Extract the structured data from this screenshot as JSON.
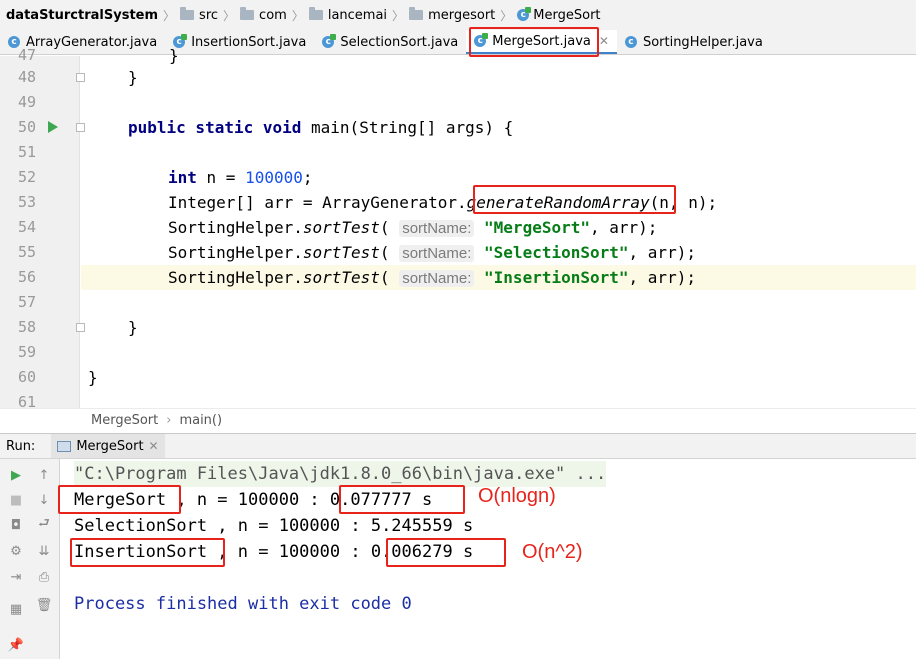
{
  "breadcrumb": {
    "items": [
      "dataSturctralSystem",
      "src",
      "com",
      "lancemai",
      "mergesort",
      "MergeSort"
    ]
  },
  "tabs": [
    {
      "label": "ArrayGenerator.java"
    },
    {
      "label": "InsertionSort.java"
    },
    {
      "label": "SelectionSort.java"
    },
    {
      "label": "MergeSort.java",
      "active": true
    },
    {
      "label": "SortingHelper.java"
    }
  ],
  "editor": {
    "current_line": "56",
    "lines": [
      {
        "num": "47",
        "code": "}"
      },
      {
        "num": "48",
        "code": "}"
      },
      {
        "num": "49",
        "code": ""
      },
      {
        "num": "50",
        "kw1": "public static void",
        "rest": " main(String[] args) {"
      },
      {
        "num": "51",
        "code": ""
      },
      {
        "num": "52",
        "kw1": "int",
        "mid": " n = ",
        "num_lit": "100000",
        "rest": ";"
      },
      {
        "num": "53",
        "pre": "Integer[] arr = ArrayGenerator.",
        "method": "generateRandomArray",
        "rest": "(n, n);"
      },
      {
        "num": "54",
        "pre": "SortingHelper.",
        "method": "sortTest",
        "paren": "(",
        "hint": "sortName:",
        "str": "\"MergeSort\"",
        "rest": ", arr);"
      },
      {
        "num": "55",
        "pre": "SortingHelper.",
        "method": "sortTest",
        "paren": "(",
        "hint": "sortName:",
        "str": "\"SelectionSort\"",
        "rest": ", arr);"
      },
      {
        "num": "56",
        "pre": "SortingHelper.",
        "method": "sortTest",
        "paren": "(",
        "hint": "sortName:",
        "str": "\"InsertionSort\"",
        "rest": ", arr);"
      },
      {
        "num": "57",
        "code": ""
      },
      {
        "num": "58",
        "code": "}"
      },
      {
        "num": "59",
        "code": ""
      },
      {
        "num": "60",
        "code": "}"
      },
      {
        "num": "61",
        "code": ""
      }
    ]
  },
  "editor_breadcrumb": {
    "class_name": "MergeSort",
    "method": "main()"
  },
  "run_panel": {
    "label": "Run:",
    "tab": "MergeSort",
    "command": "\"C:\\Program Files\\Java\\jdk1.8.0_66\\bin\\java.exe\" ...",
    "results": [
      {
        "name": "MergeSort",
        "middle": " , n = 100000 : ",
        "time": "0.077777 s"
      },
      {
        "name": "SelectionSort",
        "middle": " , n = 100000 : ",
        "time": "5.245559 s"
      },
      {
        "name": "InsertionSort",
        "middle": " , n = 100000 : ",
        "time": "0.006279 s"
      }
    ],
    "exit": "Process finished with exit code 0"
  },
  "annotations": {
    "merge_complexity": "O(nlogn)",
    "insertion_complexity": "O(n^2)",
    "color": "#e8231c"
  },
  "colors": {
    "keyword": "#000080",
    "number": "#1750eb",
    "string": "#067d17",
    "exit_text": "#1b2ea5",
    "accent_tab": "#4083c9",
    "run_arrow": "#3ea751"
  }
}
